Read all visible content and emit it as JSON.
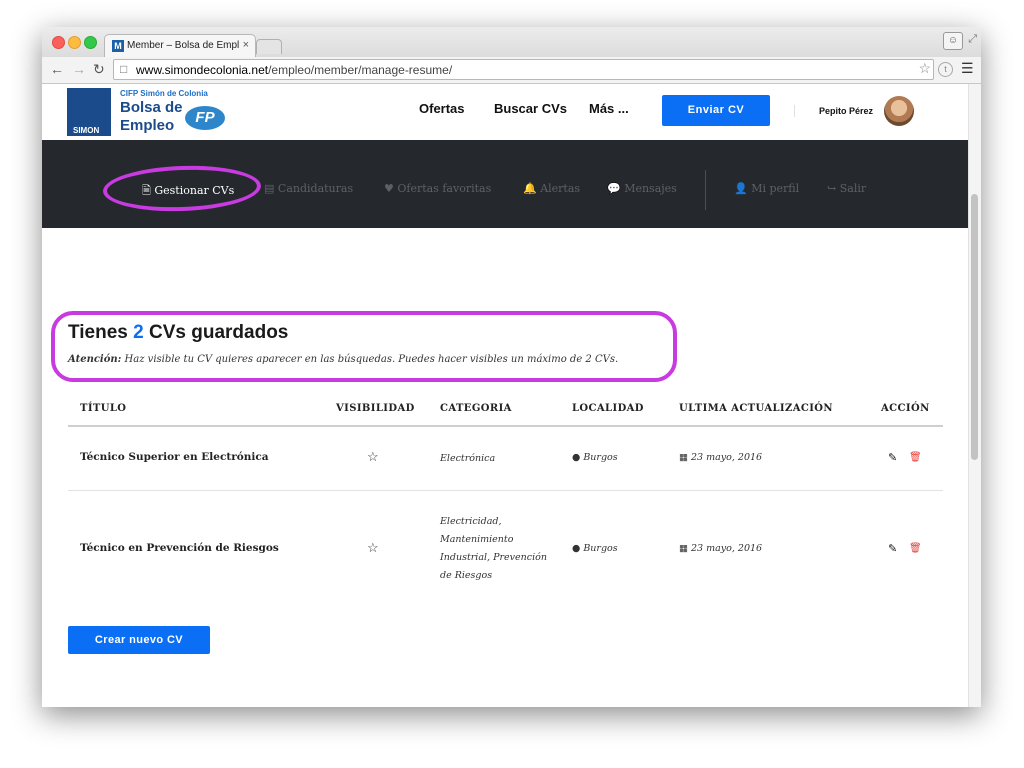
{
  "browser": {
    "tab_title": "Member – Bolsa de Empleo",
    "tab_close": "×",
    "url_domain": "www.simondecolonia.net",
    "url_path": "/empleo/member/manage-resume/"
  },
  "header": {
    "logo": {
      "small": "CIFP Simón de Colonia",
      "line1": "Bolsa de",
      "line2": "Empleo",
      "fp": "FP",
      "side": "SIMON"
    },
    "nav": [
      "Ofertas",
      "Buscar CVs",
      "Más ..."
    ],
    "cta": "Enviar CV",
    "user_name": "Pepito Pérez"
  },
  "member_nav": {
    "items": [
      {
        "icon": "🗎",
        "label": "Gestionar CVs",
        "active": true
      },
      {
        "icon": "▤",
        "label": "Candidaturas"
      },
      {
        "icon": "♥",
        "label": "Ofertas favoritas"
      },
      {
        "icon": "🔔",
        "label": "Alertas"
      },
      {
        "icon": "💬",
        "label": "Mensajes"
      },
      {
        "icon": "👤",
        "label": "Mi perfil"
      },
      {
        "icon": "↪",
        "label": "Salir"
      }
    ]
  },
  "main": {
    "heading_pre": "Tienes",
    "heading_count": "2",
    "heading_post": "CVs guardados",
    "notice_label": "Atención:",
    "notice_text": "Haz visible tu CV quieres aparecer en las búsquedas. Puedes hacer visibles un máximo de 2 CVs.",
    "table": {
      "headers": [
        "TÍTULO",
        "VISIBILIDAD",
        "CATEGORIA",
        "LOCALIDAD",
        "ULTIMA ACTUALIZACIÓN",
        "ACCIÓN"
      ],
      "rows": [
        {
          "title": "Técnico Superior en Electrónica",
          "visibility_icon": "☆",
          "category": "Electrónica",
          "location": "Burgos",
          "updated": "23 mayo, 2016"
        },
        {
          "title": "Técnico en Prevención de Riesgos",
          "visibility_icon": "☆",
          "category": "Electricidad, Mantenimiento Industrial, Prevención de Riesgos",
          "location": "Burgos",
          "updated": "23 mayo, 2016"
        }
      ]
    },
    "create_button": "Crear nuevo CV"
  },
  "colors": {
    "accent": "#0a6ff5",
    "dark_bar": "#25292d",
    "annotation": "#c83be0",
    "delete": "#e0403a"
  }
}
